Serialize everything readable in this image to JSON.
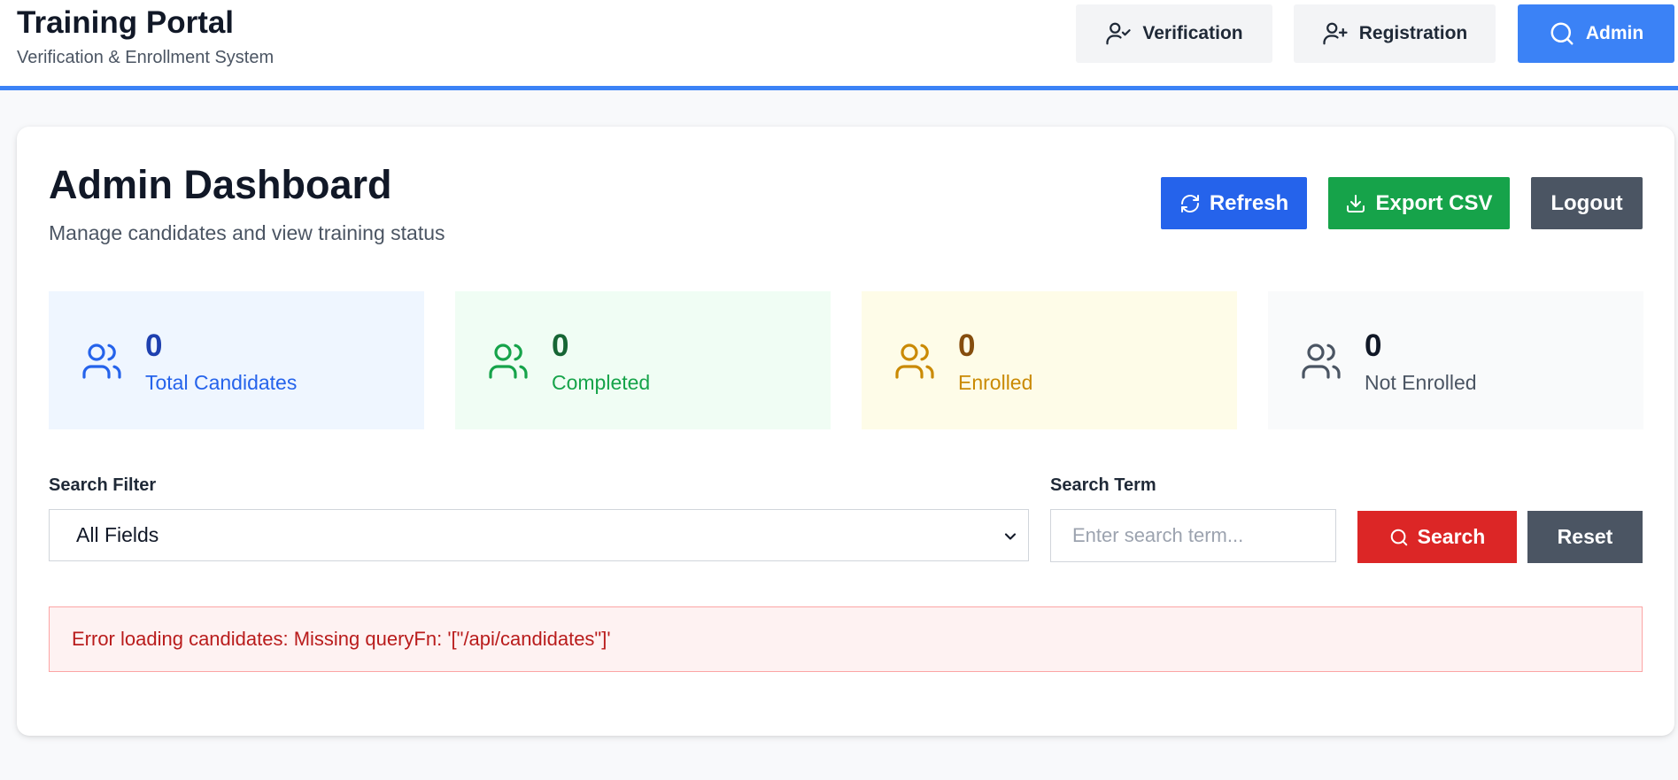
{
  "header": {
    "title": "Training Portal",
    "subtitle": "Verification & Enrollment System",
    "nav": {
      "verification": "Verification",
      "registration": "Registration",
      "admin": "Admin"
    },
    "accent_color": "#3b82f6"
  },
  "dashboard": {
    "title": "Admin Dashboard",
    "subtitle": "Manage candidates and view training status",
    "actions": {
      "refresh": "Refresh",
      "export": "Export CSV",
      "logout": "Logout"
    },
    "stats": [
      {
        "value": "0",
        "label": "Total Candidates",
        "icon": "users-icon",
        "color": "#2563eb"
      },
      {
        "value": "0",
        "label": "Completed",
        "icon": "users-icon",
        "color": "#16a34a"
      },
      {
        "value": "0",
        "label": "Enrolled",
        "icon": "users-icon",
        "color": "#ca8a04"
      },
      {
        "value": "0",
        "label": "Not Enrolled",
        "icon": "users-icon",
        "color": "#4b5563"
      }
    ],
    "filters": {
      "filter_label": "Search Filter",
      "filter_value": "All Fields",
      "term_label": "Search Term",
      "term_placeholder": "Enter search term...",
      "term_value": "",
      "search_button": "Search",
      "reset_button": "Reset"
    },
    "error": "Error loading candidates: Missing queryFn: '[\"/api/candidates\"]'"
  }
}
